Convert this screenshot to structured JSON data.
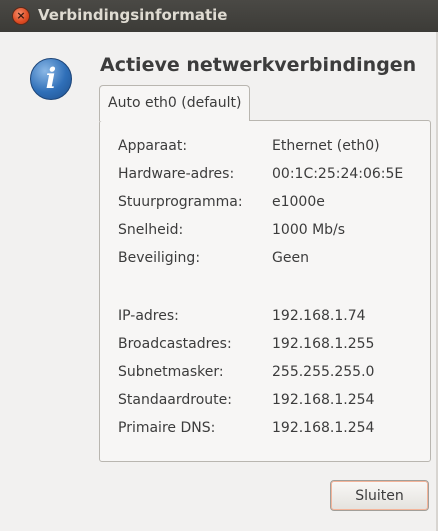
{
  "window": {
    "title": "Verbindingsinformatie"
  },
  "heading": "Actieve netwerkverbindingen",
  "tab": {
    "label": "Auto eth0 (default)"
  },
  "device_info": [
    {
      "label": "Apparaat:",
      "value": "Ethernet (eth0)"
    },
    {
      "label": "Hardware-adres:",
      "value": "00:1C:25:24:06:5E"
    },
    {
      "label": "Stuurprogramma:",
      "value": "e1000e"
    },
    {
      "label": "Snelheid:",
      "value": "1000 Mb/s"
    },
    {
      "label": "Beveiliging:",
      "value": "Geen"
    }
  ],
  "ip_info": [
    {
      "label": "IP-adres:",
      "value": "192.168.1.74"
    },
    {
      "label": "Broadcastadres:",
      "value": "192.168.1.255"
    },
    {
      "label": "Subnetmasker:",
      "value": "255.255.255.0"
    },
    {
      "label": "Standaardroute:",
      "value": "192.168.1.254"
    },
    {
      "label": "Primaire DNS:",
      "value": "192.168.1.254"
    }
  ],
  "buttons": {
    "close_label": "Sluiten"
  },
  "icons": {
    "close": "close-icon",
    "info": "info-icon"
  },
  "colors": {
    "titlebar": "#3c3b37",
    "close_button": "#de4b22",
    "info_icon": "#2f6fb8"
  }
}
